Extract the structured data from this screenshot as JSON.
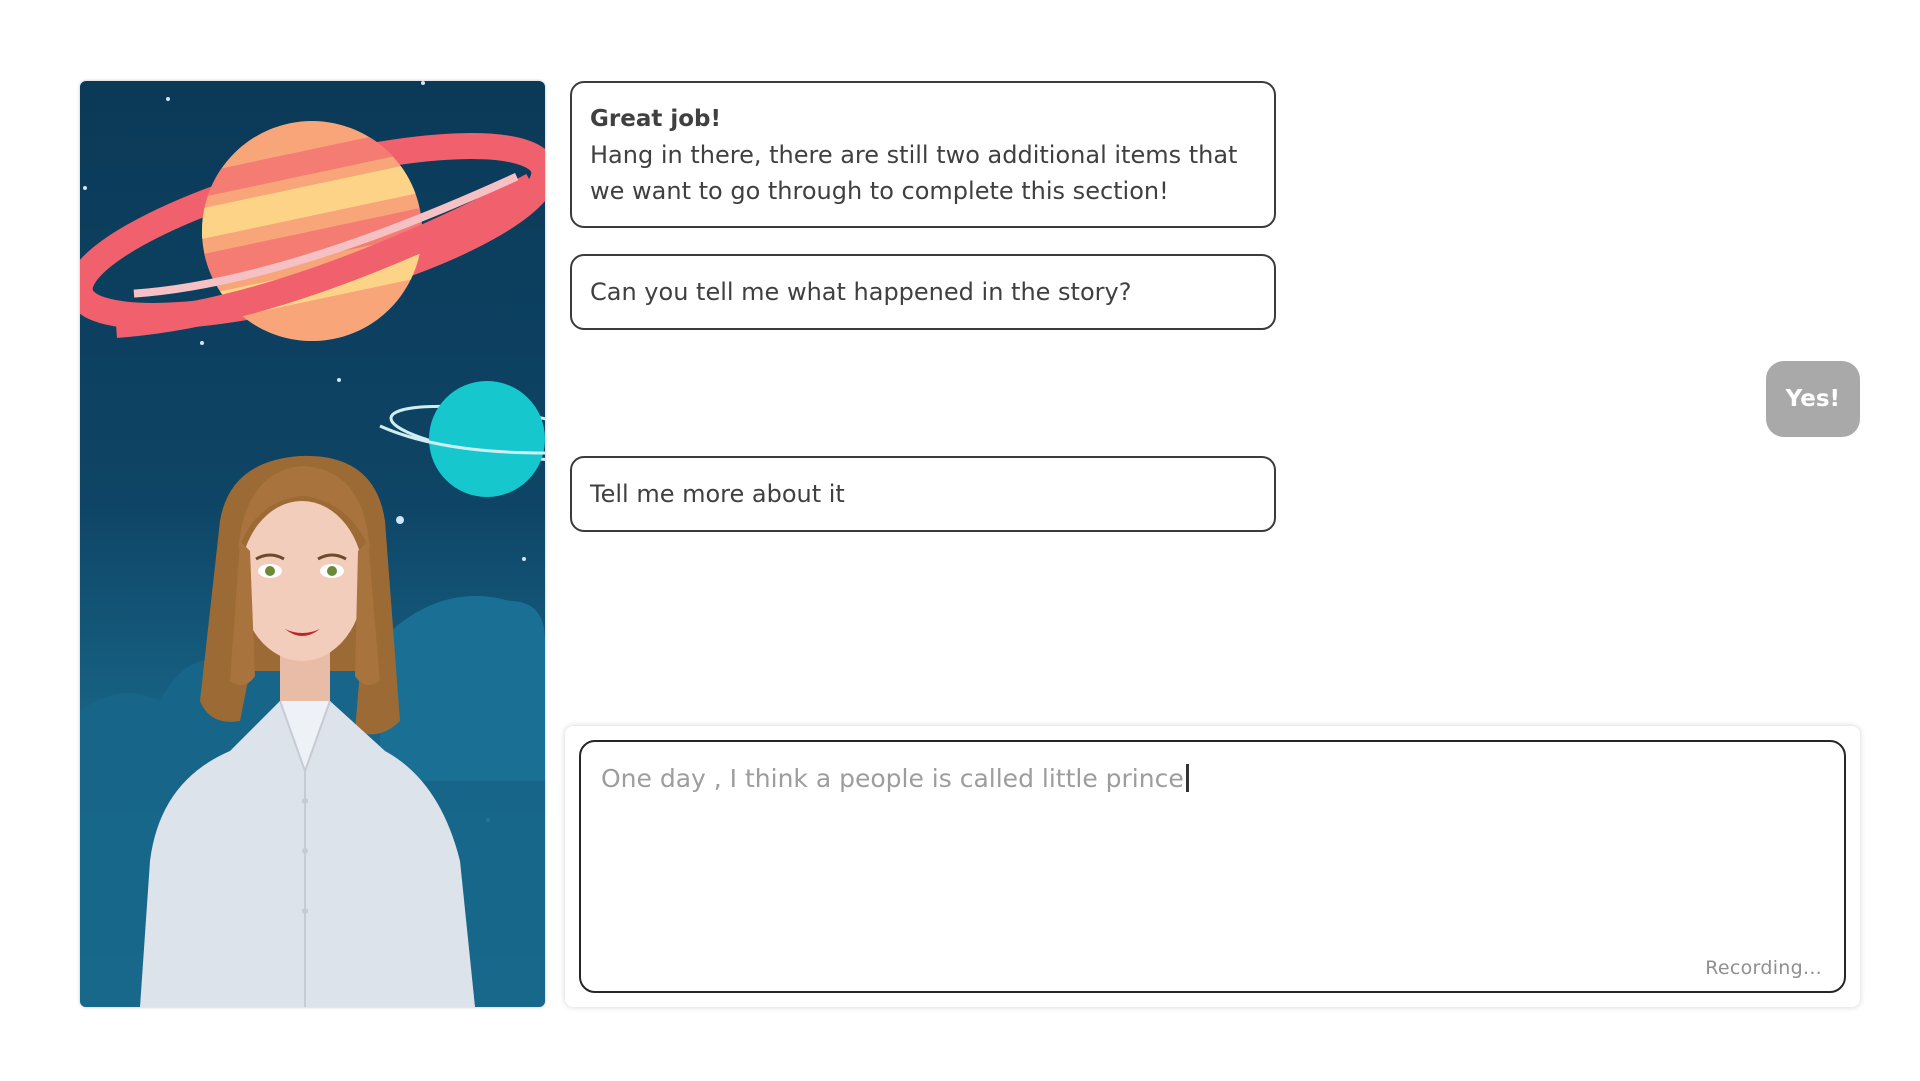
{
  "avatar": {
    "name": "avatar-character-with-space-background"
  },
  "messages": {
    "bot_1_title": "Great job!",
    "bot_1_line_1": "Hang in there, there are still two additional items that",
    "bot_1_line_2": "we want to go through to complete this section!",
    "bot_2": "Can you tell me what happened in the story?",
    "user_1": "Yes!",
    "bot_3": "Tell me more about it"
  },
  "composer": {
    "text": "One day , I think a people is called little prince",
    "status": "Recording..."
  },
  "colors": {
    "background_space": "#0e4465",
    "user_bubble": "#a9a9a9",
    "bubble_border": "#3b3b3b"
  }
}
